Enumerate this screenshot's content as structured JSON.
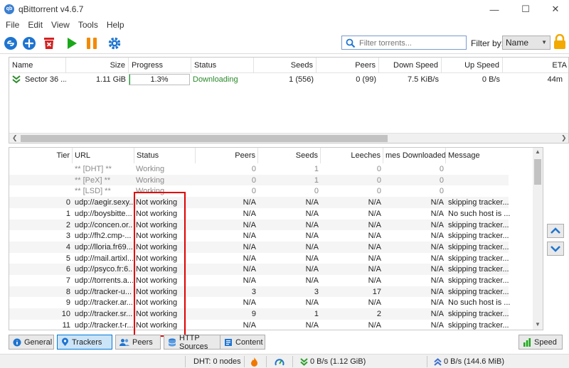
{
  "window": {
    "title": "qBittorrent v4.6.7",
    "icon_text": "qb"
  },
  "menu": [
    "File",
    "Edit",
    "View",
    "Tools",
    "Help"
  ],
  "toolbar": {
    "filter_placeholder": "Filter torrents...",
    "filter_by_label": "Filter by:",
    "filter_by_value": "Name"
  },
  "torrents": {
    "columns": [
      "Name",
      "Size",
      "Progress",
      "Status",
      "Seeds",
      "Peers",
      "Down Speed",
      "Up Speed",
      "ETA"
    ],
    "rows": [
      {
        "name": "Sector 36 ...",
        "size": "1.11 GiB",
        "progress": 1.3,
        "progress_label": "1.3%",
        "status": "Downloading",
        "seeds": "1 (556)",
        "peers": "0 (99)",
        "down_speed": "7.5 KiB/s",
        "up_speed": "0 B/s",
        "eta": "44m"
      }
    ]
  },
  "trackers": {
    "columns": [
      "Tier",
      "URL",
      "Status",
      "Peers",
      "Seeds",
      "Leeches",
      "mes Downloaded",
      "Message"
    ],
    "rows": [
      {
        "tier": "",
        "url": "** [DHT] **",
        "status": "Working",
        "peers": "0",
        "seeds": "1",
        "leeches": "0",
        "downloaded": "0",
        "message": ""
      },
      {
        "tier": "",
        "url": "** [PeX] **",
        "status": "Working",
        "peers": "0",
        "seeds": "1",
        "leeches": "0",
        "downloaded": "0",
        "message": ""
      },
      {
        "tier": "",
        "url": "** [LSD] **",
        "status": "Working",
        "peers": "0",
        "seeds": "0",
        "leeches": "0",
        "downloaded": "0",
        "message": ""
      },
      {
        "tier": "0",
        "url": "udp://aegir.sexy...",
        "status": "Not working",
        "peers": "N/A",
        "seeds": "N/A",
        "leeches": "N/A",
        "downloaded": "N/A",
        "message": "skipping tracker..."
      },
      {
        "tier": "1",
        "url": "udp://boysbitte...",
        "status": "Not working",
        "peers": "N/A",
        "seeds": "N/A",
        "leeches": "N/A",
        "downloaded": "N/A",
        "message": "No such host is ..."
      },
      {
        "tier": "2",
        "url": "udp://concen.or...",
        "status": "Not working",
        "peers": "N/A",
        "seeds": "N/A",
        "leeches": "N/A",
        "downloaded": "N/A",
        "message": "skipping tracker..."
      },
      {
        "tier": "3",
        "url": "udp://fh2.cmp-...",
        "status": "Not working",
        "peers": "N/A",
        "seeds": "N/A",
        "leeches": "N/A",
        "downloaded": "N/A",
        "message": "skipping tracker..."
      },
      {
        "tier": "4",
        "url": "udp://lloria.fr69...",
        "status": "Not working",
        "peers": "N/A",
        "seeds": "N/A",
        "leeches": "N/A",
        "downloaded": "N/A",
        "message": "skipping tracker..."
      },
      {
        "tier": "5",
        "url": "udp://mail.artixl...",
        "status": "Not working",
        "peers": "N/A",
        "seeds": "N/A",
        "leeches": "N/A",
        "downloaded": "N/A",
        "message": "skipping tracker..."
      },
      {
        "tier": "6",
        "url": "udp://psyco.fr:6...",
        "status": "Not working",
        "peers": "N/A",
        "seeds": "N/A",
        "leeches": "N/A",
        "downloaded": "N/A",
        "message": "skipping tracker..."
      },
      {
        "tier": "7",
        "url": "udp://torrents.a...",
        "status": "Not working",
        "peers": "N/A",
        "seeds": "N/A",
        "leeches": "N/A",
        "downloaded": "N/A",
        "message": "skipping tracker..."
      },
      {
        "tier": "8",
        "url": "udp://tracker-u...",
        "status": "Not working",
        "peers": "3",
        "seeds": "3",
        "leeches": "17",
        "downloaded": "N/A",
        "message": "skipping tracker..."
      },
      {
        "tier": "9",
        "url": "udp://tracker.ar...",
        "status": "Not working",
        "peers": "N/A",
        "seeds": "N/A",
        "leeches": "N/A",
        "downloaded": "N/A",
        "message": "No such host is ..."
      },
      {
        "tier": "10",
        "url": "udp://tracker.sr...",
        "status": "Not working",
        "peers": "9",
        "seeds": "1",
        "leeches": "2",
        "downloaded": "N/A",
        "message": "skipping tracker..."
      },
      {
        "tier": "11",
        "url": "udp://tracker.t-r...",
        "status": "Not working",
        "peers": "N/A",
        "seeds": "N/A",
        "leeches": "N/A",
        "downloaded": "N/A",
        "message": "skipping tracker..."
      }
    ]
  },
  "tabs": [
    "General",
    "Trackers",
    "Peers",
    "HTTP Sources",
    "Content"
  ],
  "speed_button": "Speed",
  "status": {
    "dht": "DHT: 0 nodes",
    "download": "0 B/s (1.12 GiB)",
    "upload": "0 B/s (144.6 MiB)"
  },
  "colors": {
    "accent": "#0078d7",
    "progress": "#06b025",
    "highlight": "#e00000",
    "download_arrow": "#2e9e2e",
    "upload_arrow": "#3c6fd1"
  }
}
